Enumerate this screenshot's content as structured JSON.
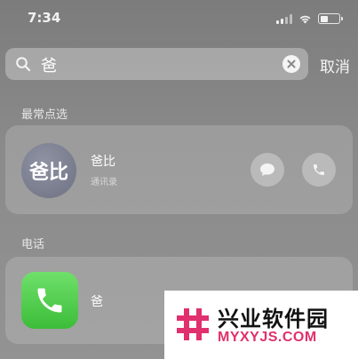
{
  "status_bar": {
    "time": "7:34",
    "battery_level": 0.4
  },
  "search": {
    "query": "爸",
    "cancel_label": "取消"
  },
  "top_hits": {
    "section_title": "最常点选",
    "contact": {
      "avatar_text": "爸比",
      "name": "爸比",
      "source": "通讯录"
    }
  },
  "phone": {
    "section_title": "电话",
    "result_name": "爸"
  },
  "watermark": {
    "title": "兴业软件园",
    "url": "MYXYJS.COM"
  },
  "icons": {
    "search": "search-icon",
    "clear": "clear-icon",
    "message": "message-icon",
    "phone": "phone-icon",
    "app": "phone-app-icon"
  },
  "colors": {
    "phone_app_green": "#4cc847",
    "watermark_pink": "#e0306e"
  }
}
